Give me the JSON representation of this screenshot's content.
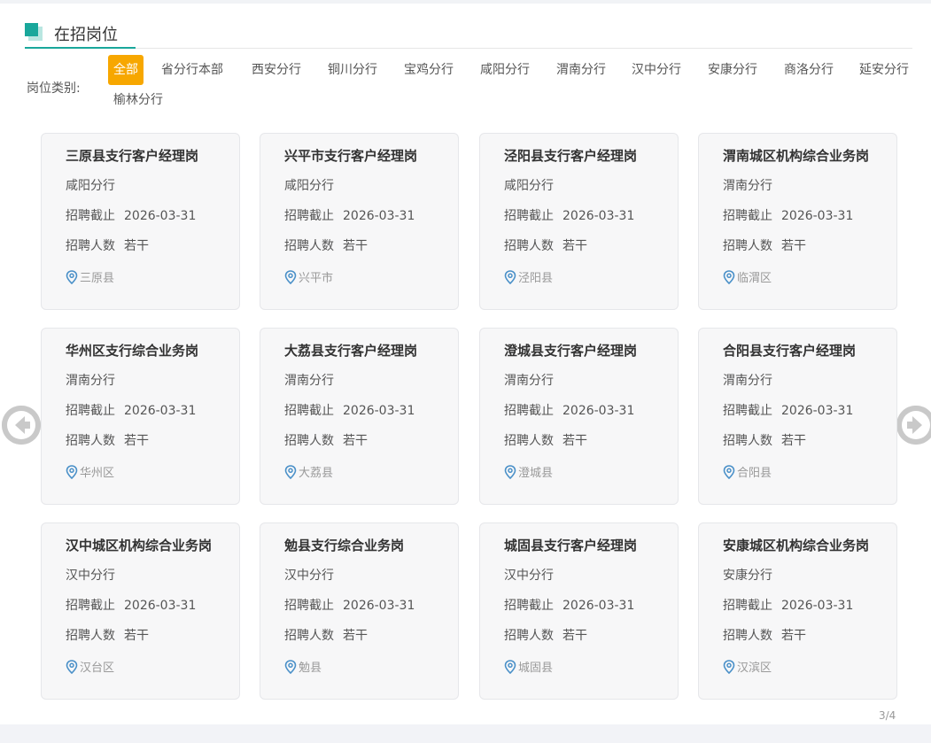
{
  "section": {
    "title": "在招岗位"
  },
  "filter": {
    "label": "岗位类别:",
    "items": [
      "全部",
      "省分行本部",
      "西安分行",
      "铜川分行",
      "宝鸡分行",
      "咸阳分行",
      "渭南分行",
      "汉中分行",
      "安康分行",
      "商洛分行",
      "延安分行",
      "榆林分行"
    ],
    "active_index": 0
  },
  "colors": {
    "accent": "#19a79b",
    "active_tab": "#f7a700",
    "card_bg": "#f7f7f8",
    "pin": "#4a90c8"
  },
  "labels": {
    "deadline": "招聘截止",
    "count": "招聘人数"
  },
  "cards": [
    {
      "title": "三原县支行客户经理岗",
      "branch": "咸阳分行",
      "deadline": "2026-03-31",
      "count": "若干",
      "location": "三原县"
    },
    {
      "title": "兴平市支行客户经理岗",
      "branch": "咸阳分行",
      "deadline": "2026-03-31",
      "count": "若干",
      "location": "兴平市"
    },
    {
      "title": "泾阳县支行客户经理岗",
      "branch": "咸阳分行",
      "deadline": "2026-03-31",
      "count": "若干",
      "location": "泾阳县"
    },
    {
      "title": "渭南城区机构综合业务岗",
      "branch": "渭南分行",
      "deadline": "2026-03-31",
      "count": "若干",
      "location": "临渭区"
    },
    {
      "title": "华州区支行综合业务岗",
      "branch": "渭南分行",
      "deadline": "2026-03-31",
      "count": "若干",
      "location": "华州区"
    },
    {
      "title": "大荔县支行客户经理岗",
      "branch": "渭南分行",
      "deadline": "2026-03-31",
      "count": "若干",
      "location": "大荔县"
    },
    {
      "title": "澄城县支行客户经理岗",
      "branch": "渭南分行",
      "deadline": "2026-03-31",
      "count": "若干",
      "location": "澄城县"
    },
    {
      "title": "合阳县支行客户经理岗",
      "branch": "渭南分行",
      "deadline": "2026-03-31",
      "count": "若干",
      "location": "合阳县"
    },
    {
      "title": "汉中城区机构综合业务岗",
      "branch": "汉中分行",
      "deadline": "2026-03-31",
      "count": "若干",
      "location": "汉台区"
    },
    {
      "title": "勉县支行综合业务岗",
      "branch": "汉中分行",
      "deadline": "2026-03-31",
      "count": "若干",
      "location": "勉县"
    },
    {
      "title": "城固县支行客户经理岗",
      "branch": "汉中分行",
      "deadline": "2026-03-31",
      "count": "若干",
      "location": "城固县"
    },
    {
      "title": "安康城区机构综合业务岗",
      "branch": "安康分行",
      "deadline": "2026-03-31",
      "count": "若干",
      "location": "汉滨区"
    }
  ],
  "pager": {
    "text": "3/4"
  }
}
